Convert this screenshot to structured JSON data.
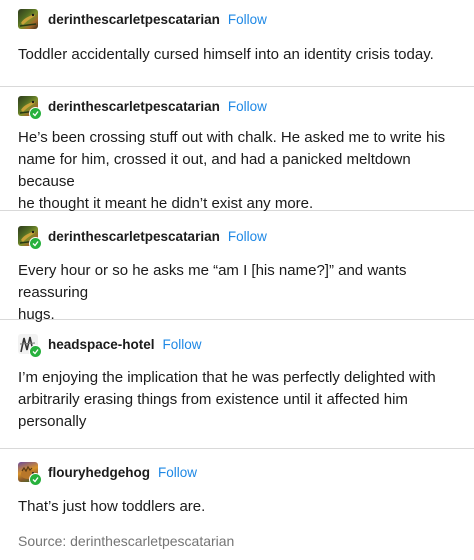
{
  "posts": [
    {
      "username": "derinthescarletpescatarian",
      "follow_label": "Follow",
      "avatar_icon": "lizard-avatar-icon",
      "lines": [
        "Toddler accidentally cursed himself into an identity crisis today."
      ]
    },
    {
      "username": "derinthescarletpescatarian",
      "follow_label": "Follow",
      "avatar_icon": "lizard-avatar-icon",
      "lines": [
        "He’s been crossing stuff out with chalk. He asked me to write his",
        "name for him, crossed it out, and had a panicked meltdown because",
        "he thought it meant he didn’t exist any more."
      ]
    },
    {
      "username": "derinthescarletpescatarian",
      "follow_label": "Follow",
      "avatar_icon": "lizard-avatar-icon",
      "lines": [
        "Every hour or so he asks me “am I [his name?]” and wants reassuring",
        "hugs."
      ]
    },
    {
      "username": "headspace-hotel",
      "follow_label": "Follow",
      "avatar_icon": "hotel-sketch-avatar-icon",
      "lines": [
        "I’m enjoying the implication that he was perfectly delighted with",
        "arbitrarily erasing things from existence until it affected him",
        "personally"
      ]
    },
    {
      "username": "flouryhedgehog",
      "follow_label": "Follow",
      "avatar_icon": "hedgehog-avatar-icon",
      "lines": [
        "That’s just how toddlers are."
      ]
    }
  ],
  "source": {
    "text": "Source: derinthescarletpescatarian"
  },
  "colors": {
    "follow": "#1e88e5",
    "badge": "#27b13d",
    "divider": "#d9d9d9",
    "source_text": "#757575"
  }
}
